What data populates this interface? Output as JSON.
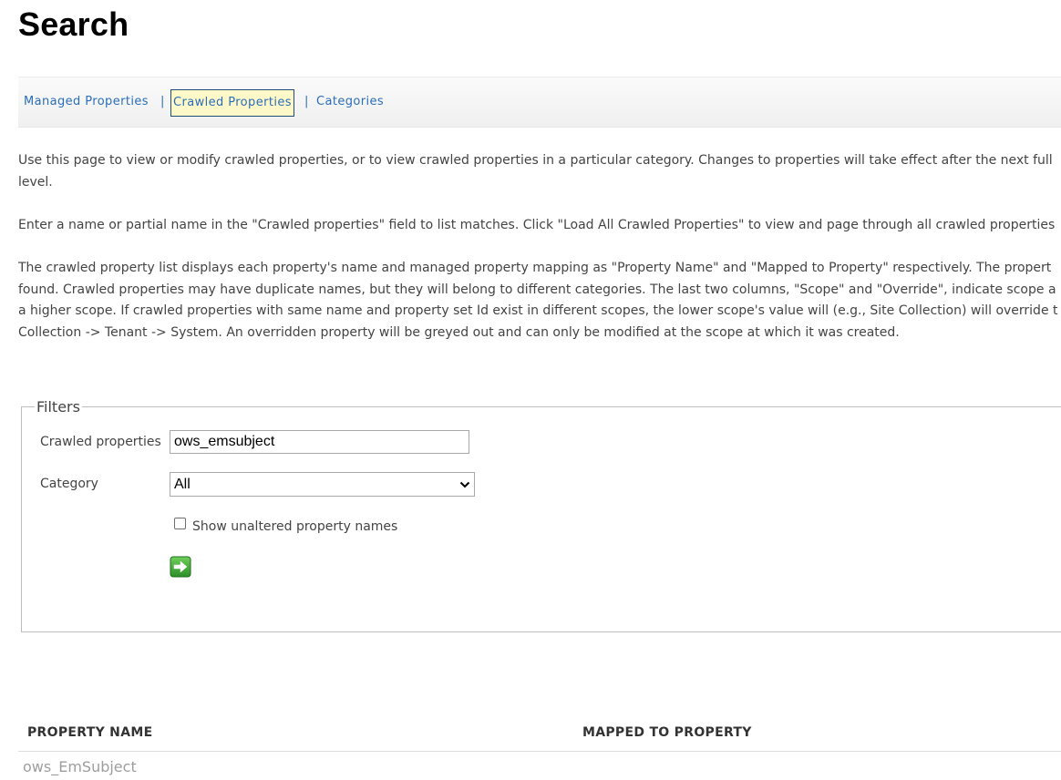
{
  "page": {
    "title": "Search"
  },
  "nav": {
    "items": [
      {
        "label": "Managed Properties",
        "active": false
      },
      {
        "label": "Crawled Properties",
        "active": true
      },
      {
        "label": "Categories",
        "active": false
      }
    ],
    "separator": "|"
  },
  "description": {
    "para1": [
      "Use this page to view or modify crawled properties, or to view crawled properties in a particular category. Changes to properties will take effect after the next full",
      "level."
    ],
    "para2": [
      "Enter a name or partial name in the \"Crawled properties\" field to list matches. Click \"Load All Crawled Properties\" to view and page through all crawled properties"
    ],
    "para3": [
      "The crawled property list displays each property's name and managed property mapping as \"Property Name\" and \"Mapped to Property\" respectively. The propert",
      "found. Crawled properties may have duplicate names, but they will belong to different categories. The last two columns, \"Scope\" and \"Override\", indicate scope a",
      "a higher scope. If crawled properties with same name and property set Id exist in different scopes, the lower scope's value will (e.g., Site Collection) will override t",
      "Collection -> Tenant -> System. An overridden property will be greyed out and can only be modified at the scope at which it was created."
    ]
  },
  "filters": {
    "legend": "Filters",
    "crawled_label": "Crawled properties",
    "crawled_value": "ows_emsubject",
    "category_label": "Category",
    "category_value": "All",
    "show_unaltered_label": "Show unaltered property names",
    "show_unaltered_checked": false,
    "go_icon": "green-arrow-right-icon"
  },
  "table": {
    "columns": [
      "PROPERTY NAME",
      "MAPPED TO PROPERTY"
    ],
    "rows": [
      {
        "property_name": "ows_EmSubject",
        "mapped_to": ""
      }
    ]
  },
  "colors": {
    "link": "#2a6ebb",
    "active_tab_bg": "#fff8c8",
    "go_button": "#3aa53a",
    "greyed_text": "#9e9e9e"
  }
}
